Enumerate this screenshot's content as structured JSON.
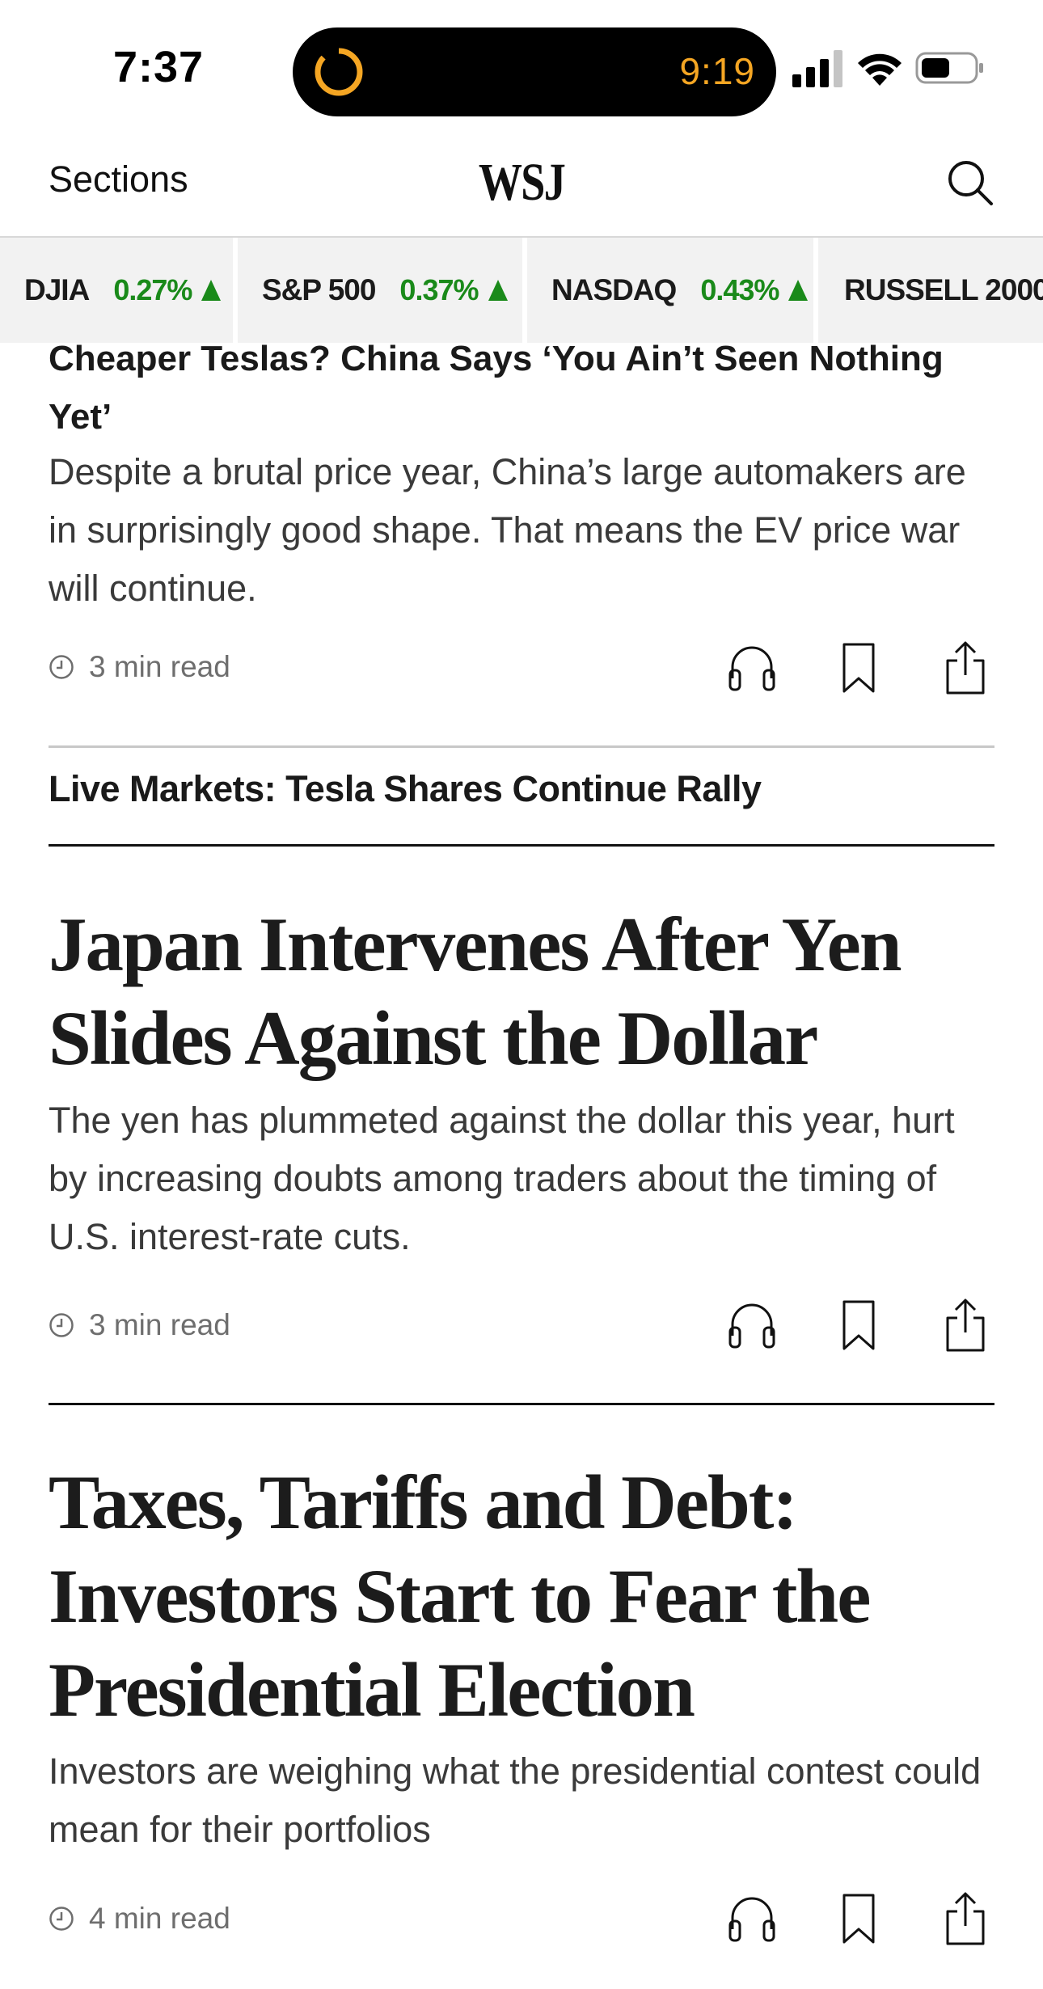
{
  "status_bar": {
    "time": "7:37",
    "island_timer": "9:19",
    "accent_color": "#f5a623"
  },
  "nav": {
    "sections_label": "Sections",
    "logo": "WSJ",
    "search_icon": "search-icon"
  },
  "ticker": [
    {
      "name": "DJIA",
      "change": "0.27%",
      "direction": "up"
    },
    {
      "name": "S&P 500",
      "change": "0.37%",
      "direction": "up"
    },
    {
      "name": "NASDAQ",
      "change": "0.43%",
      "direction": "up"
    },
    {
      "name": "RUSSELL 2000",
      "change": "",
      "direction": ""
    }
  ],
  "colors": {
    "gain": "#1a8a1a",
    "ticker_bg": "#f2f2f2"
  },
  "articles": [
    {
      "title": "Cheaper Teslas? China Says ‘You Ain’t Seen Nothing Yet’",
      "summary": "Despite a brutal price year, China’s large automakers are in surprisingly good shape. That means the EV price war will continue.",
      "read_time": "3 min read",
      "related_link": "Live Markets: Tesla Shares Continue Rally"
    },
    {
      "title": "Japan Intervenes After Yen Slides Against the Dollar",
      "summary": "The yen has plummeted against the dollar this year, hurt by increasing doubts among traders about the timing of U.S. interest-rate cuts.",
      "read_time": "3 min read"
    },
    {
      "title": "Taxes, Tariffs and Debt: Investors Start to Fear the Presidential Election",
      "summary": "Investors are weighing what the presidential contest could mean for their portfolios",
      "read_time": "4 min read"
    }
  ],
  "action_icons": [
    "headphones-icon",
    "bookmark-icon",
    "share-icon"
  ]
}
